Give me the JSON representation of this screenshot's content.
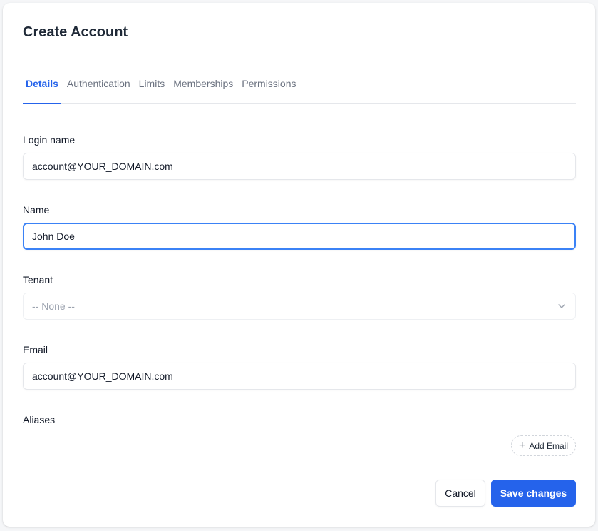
{
  "dialog": {
    "title": "Create Account"
  },
  "tabs": [
    {
      "label": "Details",
      "active": true
    },
    {
      "label": "Authentication",
      "active": false
    },
    {
      "label": "Limits",
      "active": false
    },
    {
      "label": "Memberships",
      "active": false
    },
    {
      "label": "Permissions",
      "active": false
    }
  ],
  "form": {
    "login_name": {
      "label": "Login name",
      "value": "account@YOUR_DOMAIN.com"
    },
    "name": {
      "label": "Name",
      "value": "John Doe"
    },
    "tenant": {
      "label": "Tenant",
      "value": "-- None --"
    },
    "email": {
      "label": "Email",
      "value": "account@YOUR_DOMAIN.com"
    },
    "aliases": {
      "label": "Aliases",
      "add_label": "Add Email"
    }
  },
  "actions": {
    "cancel_label": "Cancel",
    "save_label": "Save changes"
  },
  "colors": {
    "accent": "#2563eb",
    "focus_ring": "#3b82f6",
    "muted_text": "#6b7280"
  },
  "icons": {
    "select_chevron": "chevron-down-icon",
    "add": "plus-icon"
  }
}
